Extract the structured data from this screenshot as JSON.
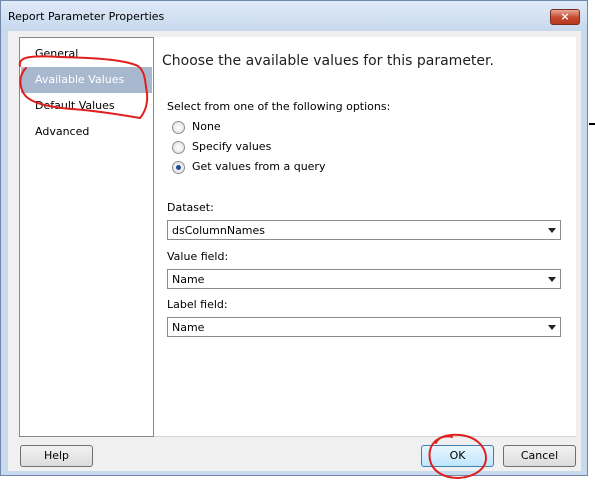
{
  "window": {
    "title": "Report Parameter Properties",
    "close_glyph": "×"
  },
  "nav": {
    "items": [
      {
        "label": "General",
        "selected": false
      },
      {
        "label": "Available Values",
        "selected": true
      },
      {
        "label": "Default Values",
        "selected": false
      },
      {
        "label": "Advanced",
        "selected": false
      }
    ]
  },
  "content": {
    "heading": "Choose the available values for this parameter.",
    "options_label": "Select from one of the following options:",
    "options": [
      {
        "label": "None",
        "checked": false
      },
      {
        "label": "Specify values",
        "checked": false
      },
      {
        "label": "Get values from a query",
        "checked": true
      }
    ],
    "dataset": {
      "label": "Dataset:",
      "value": "dsColumnNames"
    },
    "value_field": {
      "label": "Value field:",
      "value": "Name"
    },
    "label_field": {
      "label": "Label field:",
      "value": "Name"
    }
  },
  "buttons": {
    "help": "Help",
    "ok": "OK",
    "cancel": "Cancel"
  },
  "colors": {
    "annotation": "#e0201c",
    "selected_nav": "#a7b8cf",
    "window_frame": "#c9daee"
  }
}
